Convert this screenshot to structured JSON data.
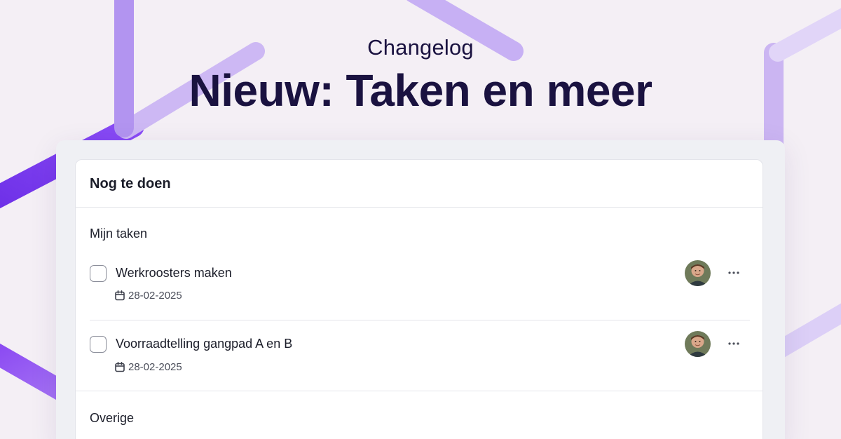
{
  "header": {
    "eyebrow": "Changelog",
    "headline": "Nieuw: Taken en meer"
  },
  "panel": {
    "title": "Nog te doen",
    "sections": [
      {
        "label": "Mijn taken",
        "tasks": [
          {
            "title": "Werkroosters maken",
            "date": "28-02-2025",
            "checked": false
          },
          {
            "title": "Voorraadtelling gangpad A en B",
            "date": "28-02-2025",
            "checked": false
          }
        ]
      },
      {
        "label": "Overige",
        "tasks": []
      }
    ]
  },
  "icons": {
    "date": "calendar-icon",
    "more": "more-horizontal-icon",
    "assignee": "avatar"
  },
  "colors": {
    "background": "#f4eff5",
    "headline": "#1a1240",
    "accent_purple": "#7a3cf2",
    "accent_lavender": "#c9b3f3",
    "card_frame": "#eff0f4",
    "panel": "#ffffff"
  }
}
